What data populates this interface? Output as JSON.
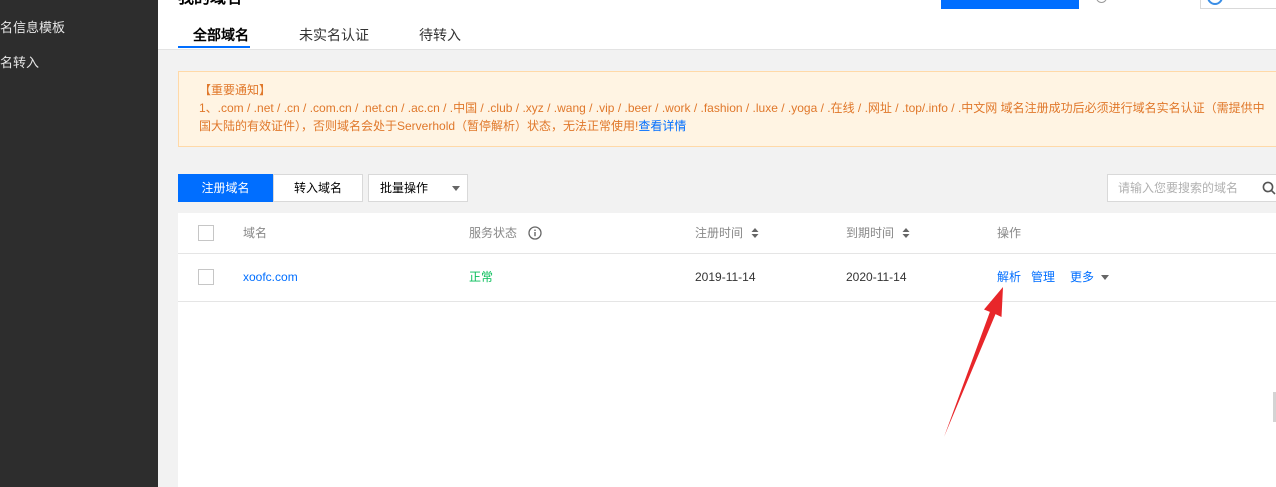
{
  "sidebar": {
    "items": [
      {
        "label": "名信息模板"
      },
      {
        "label": "名转入"
      }
    ]
  },
  "header": {
    "title": "我的域名",
    "tabs": [
      {
        "label": "全部域名",
        "active": true
      },
      {
        "label": "未实名认证",
        "active": false
      },
      {
        "label": "待转入",
        "active": false
      }
    ]
  },
  "notice": {
    "title": "【重要通知】",
    "lines": [
      "1、.com / .net / .cn / .com.cn / .net.cn / .ac.cn / .中国 / .club / .xyz / .wang / .vip / .beer / .work / .fashion / .luxe / .yoga / .在线 / .网址 / .top/.info / .中文网 域名注册成功后必须进行域名实名认证（需提供中",
      "国大陆的有效证件），否则域名会处于Serverhold（暂停解析）状态，无法正常使用!"
    ],
    "link": "查看详情"
  },
  "toolbar": {
    "register_label": "注册域名",
    "transfer_label": "转入域名",
    "batch_select_value": "批量操作",
    "search_placeholder": "请输入您要搜索的域名"
  },
  "table": {
    "columns": {
      "domain": "域名",
      "status": "服务状态",
      "registered": "注册时间",
      "expires": "到期时间",
      "actions": "操作"
    },
    "rows": [
      {
        "selected": false,
        "domain": "xoofc.com",
        "status": "正常",
        "registered": "2019-11-14",
        "expires": "2020-11-14",
        "actions": {
          "resolve": "解析",
          "manage": "管理",
          "more": "更多"
        }
      }
    ]
  },
  "icons": [
    "info-icon",
    "sort-icon",
    "caret-down-icon",
    "search-icon",
    "help-icon",
    "user-icon",
    "annotation-arrow"
  ],
  "colors": {
    "sidebar_bg": "#2d2d2d",
    "accent": "#006eff",
    "status_ok": "#0abf5b",
    "notice_bg": "#fff4e3",
    "notice_text": "#e0782b",
    "page_bg": "#f2f2f2",
    "annotation_arrow": "#e8262a"
  }
}
